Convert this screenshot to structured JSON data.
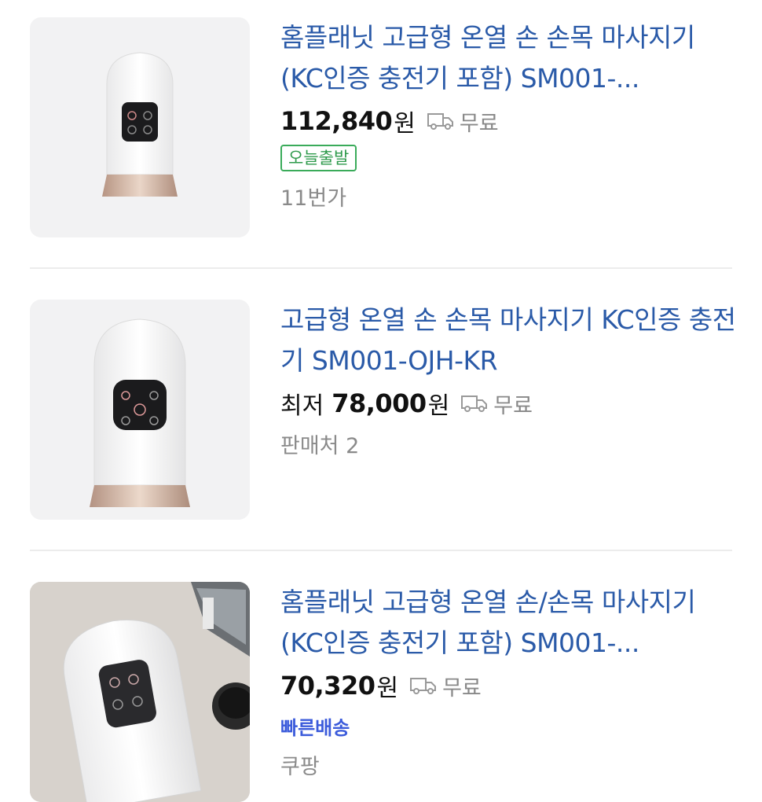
{
  "listings": [
    {
      "title": "홈플래닛 고급형 온열 손 손목 마사지기 (KC인증 충전기 포함) SM001-...",
      "price_prefix": "",
      "price": "112,840",
      "currency": "원",
      "shipping": "무료",
      "badge": "오늘출발",
      "seller": "11번가",
      "icon": "delivery-truck-icon"
    },
    {
      "title": "고급형 온열 손 손목 마사지기 KC인증 충전기 SM001-OJH-KR",
      "price_prefix": "최저",
      "price": "78,000",
      "currency": "원",
      "shipping": "무료",
      "seller": "판매처 2",
      "icon": "delivery-truck-icon"
    },
    {
      "title": "홈플래닛 고급형 온열 손/손목 마사지기 (KC인증 충전기 포함) SM001-...",
      "price_prefix": "",
      "price": "70,320",
      "currency": "원",
      "shipping": "무료",
      "fast_delivery": "빠른배송",
      "seller": "쿠팡",
      "icon": "delivery-truck-icon"
    }
  ],
  "colors": {
    "title": "#2a5aa8",
    "badge_green": "#2e9a4b",
    "fast_blue": "#3b5bdb",
    "product_accent": "#c9a48a"
  }
}
